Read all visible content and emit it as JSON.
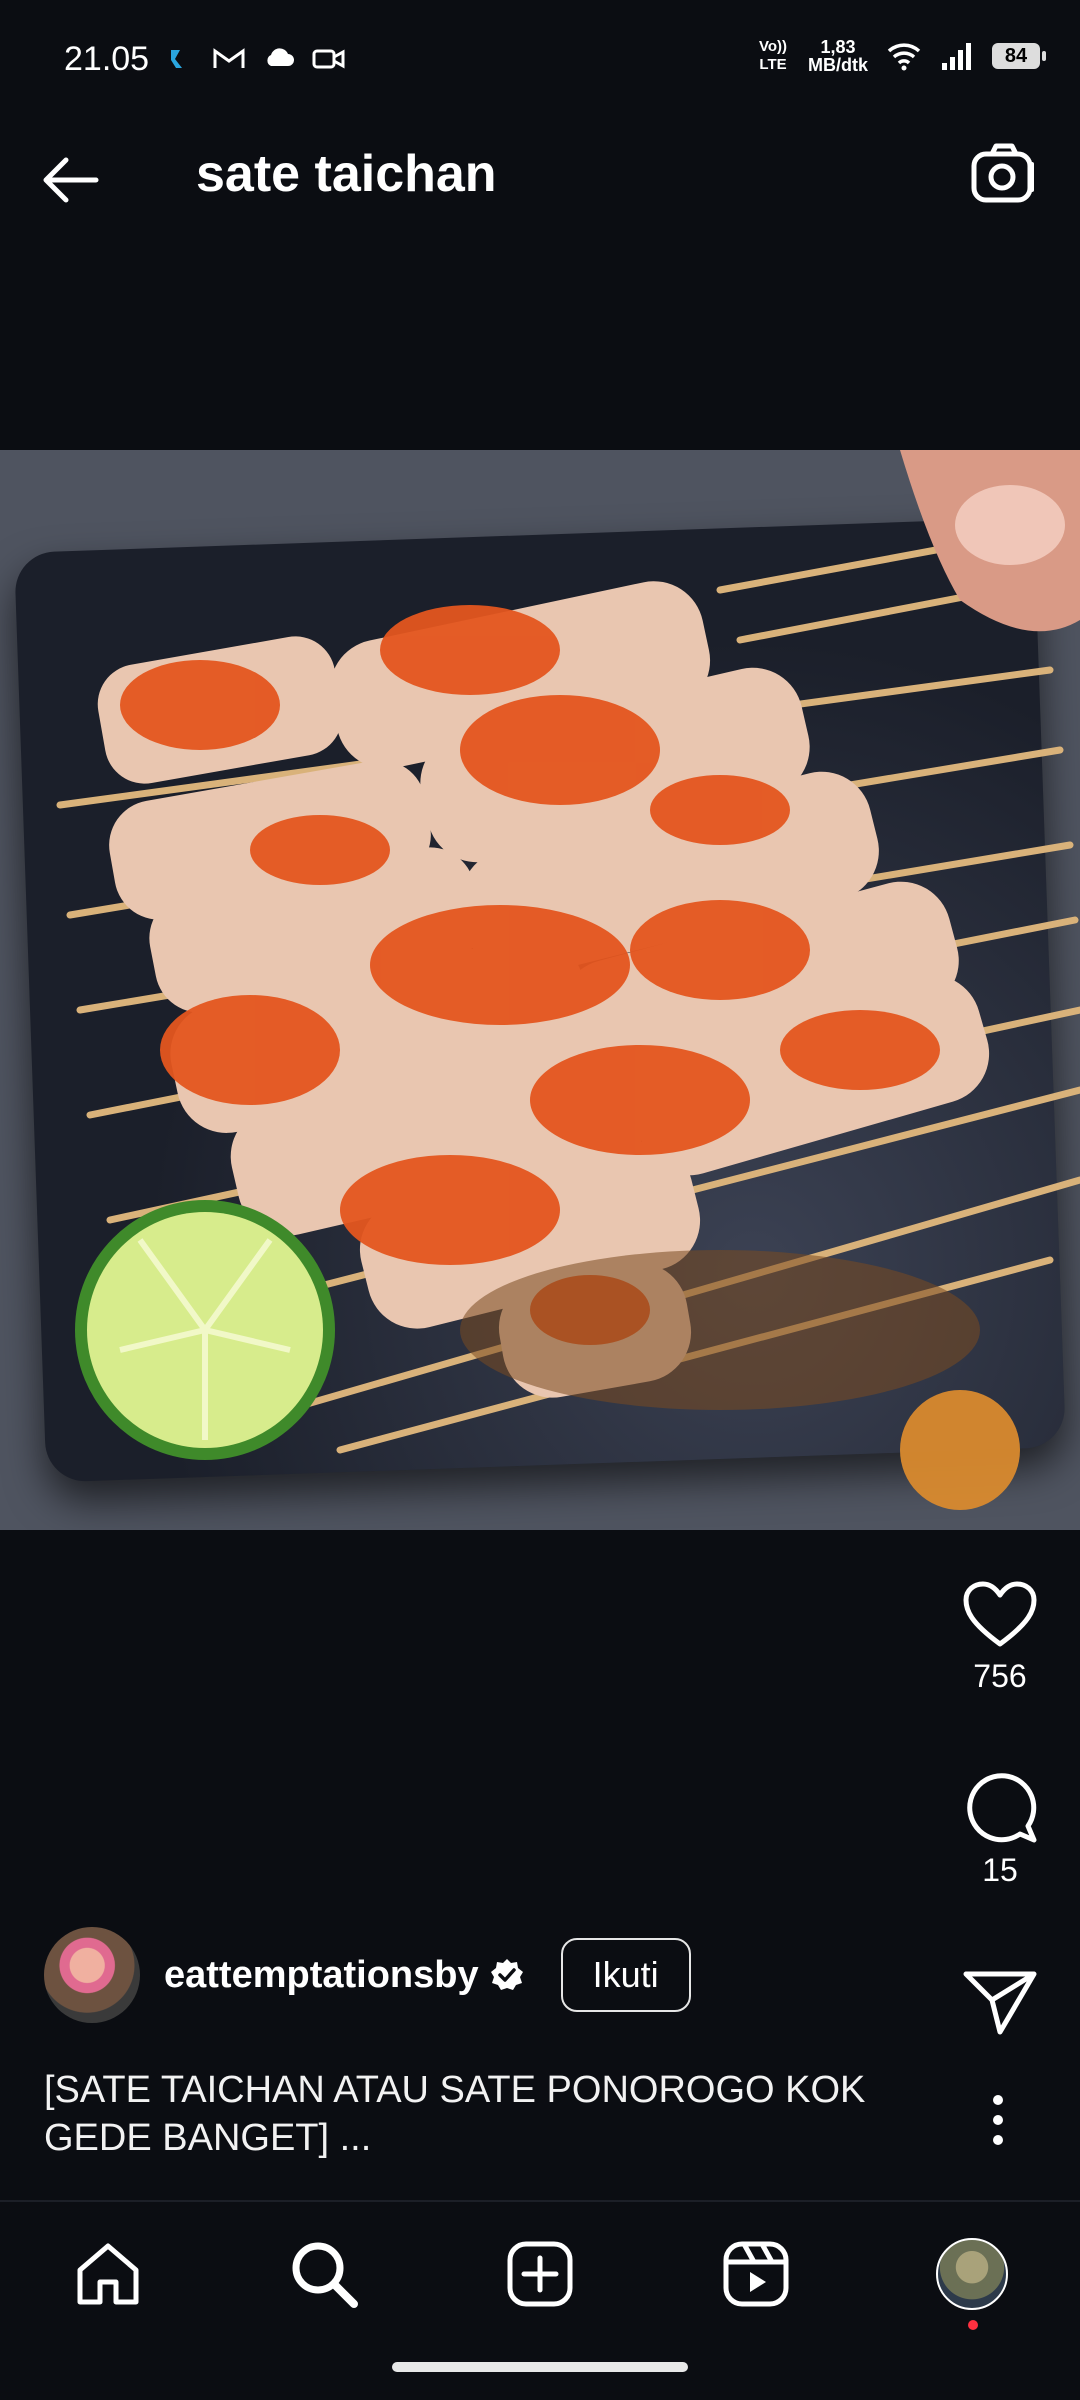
{
  "status_bar": {
    "time": "21.05",
    "network_top": "1,83",
    "network_bottom": "MB/dtk",
    "volte": "Vo)) LTE",
    "battery": "84"
  },
  "header": {
    "title": "sate taichan"
  },
  "post": {
    "likes": "756",
    "comments": "15",
    "author": "eattemptationsby",
    "follow_label": "Ikuti",
    "caption": "[SATE TAICHAN ATAU SATE PONOROGO KOK GEDE BANGET] ..."
  },
  "colors": {
    "background": "#0b0d12",
    "notification_dot": "#ff3040",
    "text": "#ffffff"
  },
  "icons": {
    "back": "arrow-left-icon",
    "camera": "camera-icon",
    "like": "heart-icon",
    "comment": "comment-icon",
    "share": "send-icon",
    "more": "more-vertical-icon",
    "nav": [
      "home-icon",
      "search-icon",
      "add-icon",
      "reels-icon",
      "profile-avatar"
    ]
  }
}
